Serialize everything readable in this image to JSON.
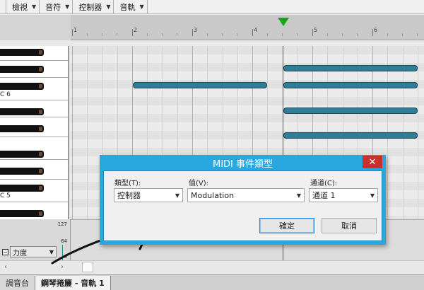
{
  "menu": {
    "items": [
      {
        "label": "檢視"
      },
      {
        "label": "音符"
      },
      {
        "label": "控制器"
      },
      {
        "label": "音軌"
      }
    ]
  },
  "ruler": {
    "labels": [
      "1",
      "2",
      "3",
      "4",
      "5",
      "6"
    ]
  },
  "piano": {
    "labels": [
      "C 6",
      "C 5"
    ]
  },
  "controller": {
    "max": "127",
    "mid": "64",
    "min": "0",
    "velocity_select": "力度"
  },
  "tabs": [
    {
      "label": "調音台"
    },
    {
      "label": "鋼琴捲簾 - 音軌 1"
    }
  ],
  "dialog": {
    "title": "MIDI 事件類型",
    "close_symbol": "✕",
    "type_label": "類型(T):",
    "type_value": "控制器",
    "value_label": "值(V):",
    "value_value": "Modulation",
    "channel_label": "通道(C):",
    "channel_value": "通道 1",
    "ok_label": "確定",
    "cancel_label": "取消"
  },
  "colors": {
    "note": "#2f7d96",
    "playhead": "#1ca31c",
    "dialog_frame": "#29a8e0",
    "close_button": "#c9302c"
  }
}
